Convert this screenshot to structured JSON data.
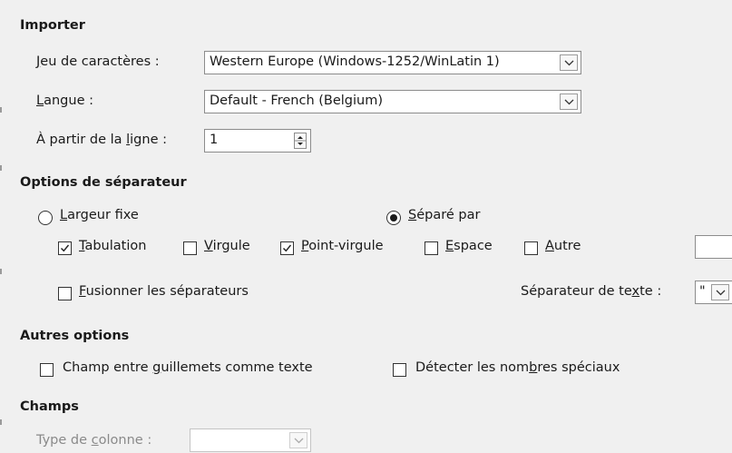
{
  "importer": {
    "title": "Importer",
    "charset": {
      "label_prefix": "",
      "label_u": "J",
      "label_rest": "eu de caractères :",
      "value": "Western Europe (Windows-1252/WinLatin 1)"
    },
    "language": {
      "label_u": "L",
      "label_rest": "angue :",
      "value": "Default - French (Belgium)"
    },
    "from_row": {
      "label_pre": "À partir de la ",
      "label_u": "l",
      "label_rest": "igne :",
      "value": "1"
    }
  },
  "separator_options": {
    "title": "Options de séparateur",
    "fixed_width": {
      "label_u": "L",
      "label_rest": "argeur fixe",
      "selected": false
    },
    "separated_by": {
      "label_u": "S",
      "label_rest": "éparé par",
      "selected": true
    },
    "tab": {
      "label_u": "T",
      "label_rest": "abulation",
      "checked": true
    },
    "comma": {
      "label_u": "V",
      "label_rest": "irgule",
      "checked": false
    },
    "semicolon": {
      "label_u": "P",
      "label_rest": "oint-virgule",
      "checked": true
    },
    "space": {
      "label_u": "E",
      "label_rest": "space",
      "checked": false
    },
    "other": {
      "label_u": "A",
      "label_rest": "utre",
      "checked": false
    },
    "merge": {
      "label_u": "F",
      "label_rest": "usionner les séparateurs",
      "checked": false
    },
    "text_sep": {
      "label_pre": "Séparateur de te",
      "label_u": "x",
      "label_rest": "te :",
      "value": "\""
    }
  },
  "other_options": {
    "title": "Autres options",
    "quoted": {
      "label_pre": "Champ entre ",
      "label_u": "g",
      "label_rest": "uillemets comme texte",
      "checked": false
    },
    "special_numbers": {
      "label_pre": "Détecter les nom",
      "label_u": "b",
      "label_rest": "res spéciaux",
      "checked": false
    }
  },
  "fields": {
    "title": "Champs",
    "column_type": {
      "label_pre": "Type de ",
      "label_u": "c",
      "label_rest": "olonne :",
      "value": ""
    }
  },
  "icons": {
    "dropdown": "chevron-down-icon",
    "spin_up": "triangle-up-icon",
    "spin_down": "triangle-down-icon",
    "check": "checkmark-icon"
  }
}
